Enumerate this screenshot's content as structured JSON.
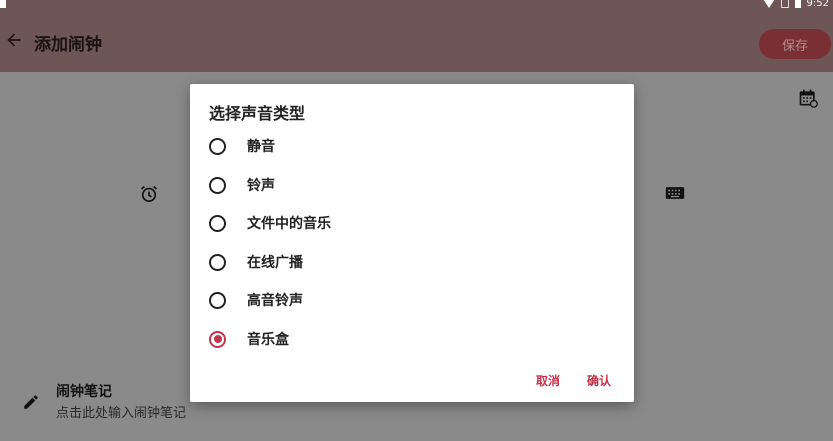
{
  "status_bar": {
    "time": "9:52"
  },
  "app_bar": {
    "title": "添加闹钟",
    "save_label": "保存"
  },
  "background": {
    "note_title": "闹钟笔记",
    "note_hint": "点击此处输入闹钟笔记"
  },
  "dialog": {
    "title": "选择声音类型",
    "options": [
      {
        "label": "静音",
        "selected": false
      },
      {
        "label": "铃声",
        "selected": false
      },
      {
        "label": "文件中的音乐",
        "selected": false
      },
      {
        "label": "在线广播",
        "selected": false
      },
      {
        "label": "高音铃声",
        "selected": false
      },
      {
        "label": "音乐盒",
        "selected": true
      }
    ],
    "cancel_label": "取消",
    "confirm_label": "确认"
  },
  "colors": {
    "accent": "#c2344a",
    "app_bar": "#6e5656",
    "scrim": "#8a8a8a"
  }
}
